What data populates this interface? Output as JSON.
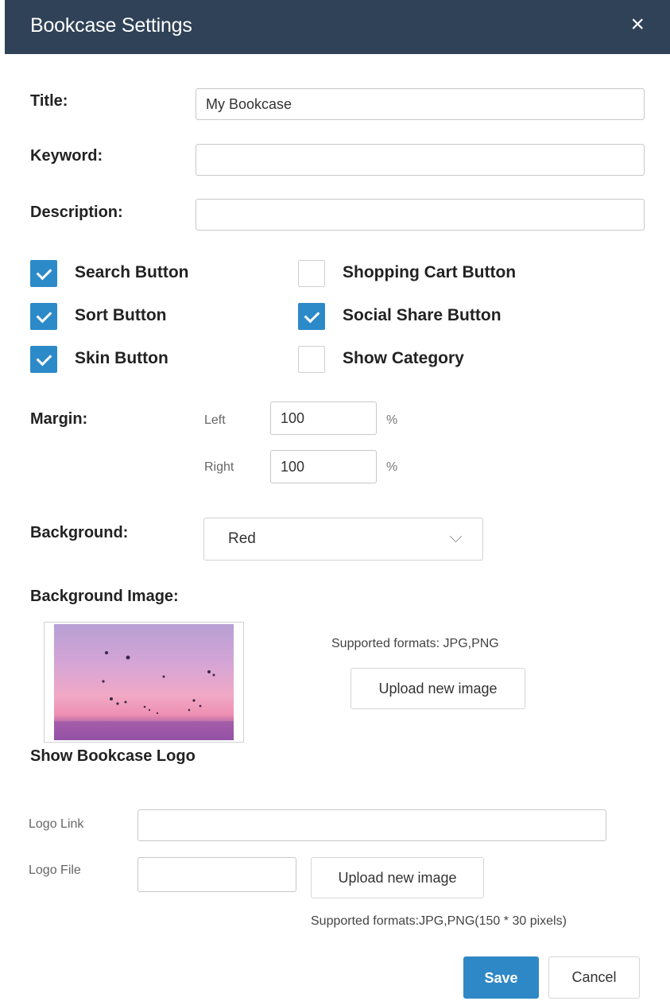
{
  "dialog": {
    "title": "Bookcase Settings",
    "close_glyph": "×"
  },
  "fields": {
    "title": {
      "label": "Title:",
      "value": "My Bookcase"
    },
    "keyword": {
      "label": "Keyword:",
      "value": ""
    },
    "description": {
      "label": "Description:",
      "value": ""
    }
  },
  "checkboxes": [
    {
      "label": "Search Button",
      "checked": true
    },
    {
      "label": "Shopping Cart Button",
      "checked": false
    },
    {
      "label": "Sort Button",
      "checked": true
    },
    {
      "label": "Social Share Button",
      "checked": true
    },
    {
      "label": "Skin Button",
      "checked": true
    },
    {
      "label": "Show Category",
      "checked": false
    }
  ],
  "margin": {
    "label": "Margin:",
    "left": {
      "label": "Left",
      "value": "100",
      "unit": "%"
    },
    "right": {
      "label": "Right",
      "value": "100",
      "unit": "%"
    }
  },
  "background": {
    "label": "Background:",
    "selected": "Red"
  },
  "background_image": {
    "label": "Background Image:",
    "supported": "Supported formats: JPG,PNG",
    "upload_label": "Upload new image"
  },
  "logo": {
    "heading": "Show Bookcase Logo",
    "link_label": "Logo Link",
    "link_value": "",
    "file_label": "Logo File",
    "file_value": "",
    "upload_label": "Upload new image",
    "supported": "Supported formats:JPG,PNG(150 * 30 pixels)"
  },
  "actions": {
    "save": "Save",
    "cancel": "Cancel"
  },
  "colors": {
    "header_bg": "#2f4257",
    "accent": "#2d8ac9"
  },
  "icons": {
    "close": "close-icon",
    "check": "check-icon",
    "dropdown": "chevron-down-icon"
  }
}
